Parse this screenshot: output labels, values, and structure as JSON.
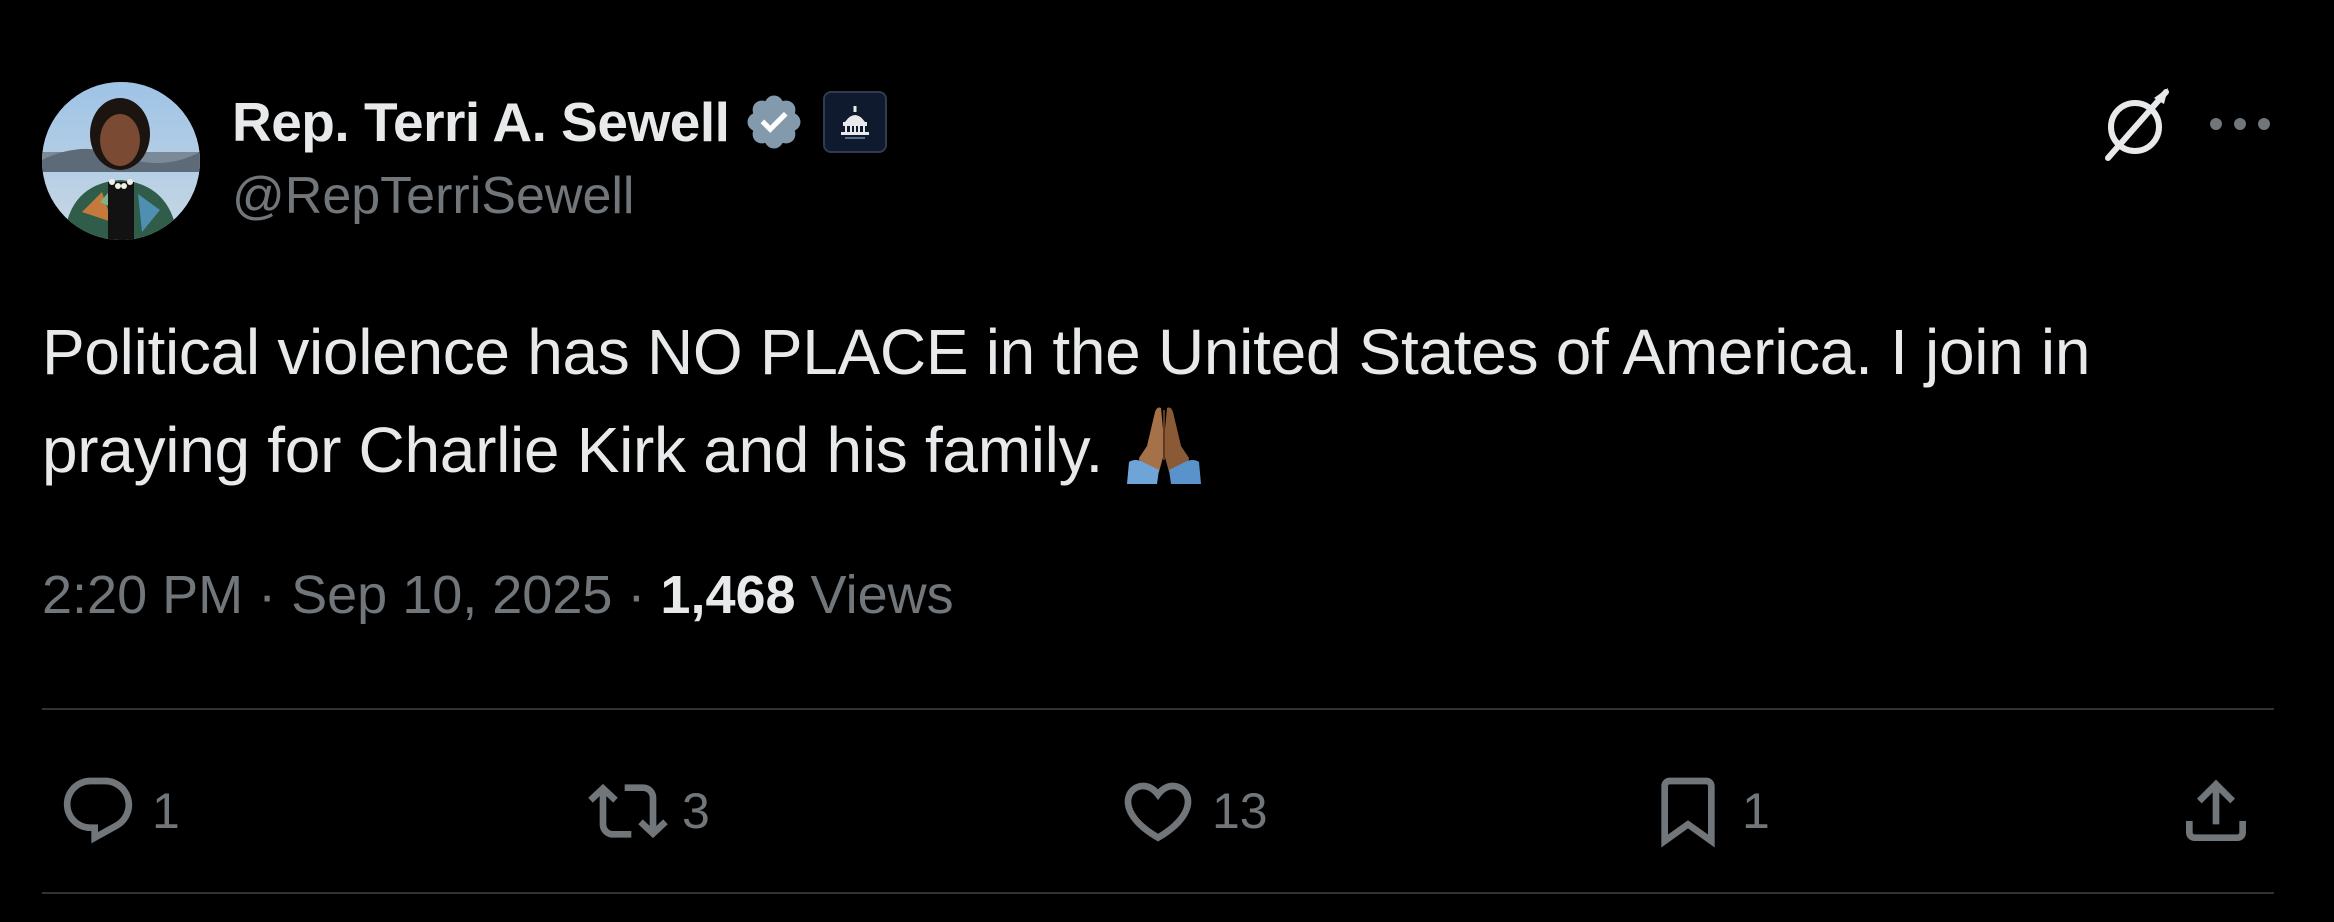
{
  "author": {
    "display_name": "Rep. Terri A. Sewell",
    "handle": "@RepTerriSewell",
    "verified_icon": "verified-badge-icon",
    "affiliate_icon": "capitol-affiliate-icon"
  },
  "header_icons": {
    "grok": "grok-icon",
    "more": "more-options-icon"
  },
  "tweet": {
    "text": "Political violence has NO PLACE in the United States of America. I join in praying for Charlie Kirk and his family.",
    "emoji": "folded-hands-emoji"
  },
  "meta": {
    "time": "2:20 PM",
    "separator1": " · ",
    "date": "Sep 10, 2025",
    "separator2": " · ",
    "views_count": "1,468",
    "views_label": " Views"
  },
  "actions": {
    "reply": {
      "icon": "reply-icon",
      "count": "1"
    },
    "repost": {
      "icon": "repost-icon",
      "count": "3"
    },
    "like": {
      "icon": "like-icon",
      "count": "13"
    },
    "bookmark": {
      "icon": "bookmark-icon",
      "count": "1"
    },
    "share": {
      "icon": "share-icon"
    }
  },
  "colors": {
    "background": "#000000",
    "primary_text": "#e7e9ea",
    "secondary_text": "#71767b",
    "divider": "#2f3336",
    "verified": "#829aab"
  }
}
